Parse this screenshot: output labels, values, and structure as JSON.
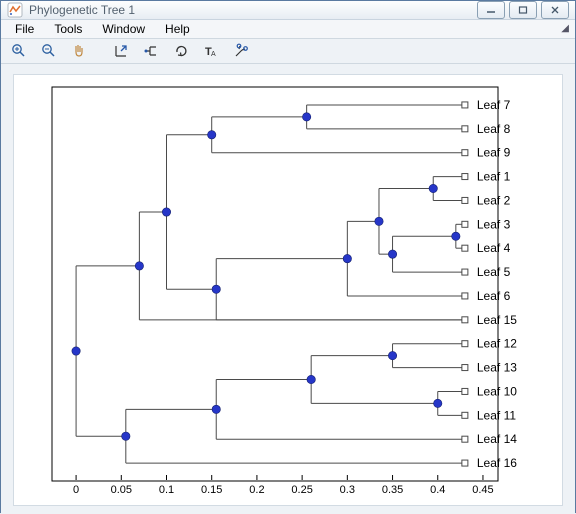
{
  "window": {
    "title": "Phylogenetic Tree 1"
  },
  "menu": {
    "file": "File",
    "tools": "Tools",
    "window": "Window",
    "help": "Help"
  },
  "toolbar_icons": [
    "zoom-in-icon",
    "zoom-out-icon",
    "pan-icon",
    "collapse-icon",
    "rotate-icon",
    "swap-icon",
    "rename-icon",
    "prune-icon"
  ],
  "chart_data": {
    "type": "phylotree",
    "x_ticks": [
      "0",
      "0.05",
      "0.1",
      "0.15",
      "0.2",
      "0.25",
      "0.3",
      "0.35",
      "0.4",
      "0.45"
    ],
    "x_range": [
      -0.02,
      0.46
    ],
    "leaves": [
      {
        "label": "Leaf 7",
        "x": 0.43
      },
      {
        "label": "Leaf 8",
        "x": 0.43
      },
      {
        "label": "Leaf 9",
        "x": 0.43
      },
      {
        "label": "Leaf 1",
        "x": 0.43
      },
      {
        "label": "Leaf 2",
        "x": 0.43
      },
      {
        "label": "Leaf 3",
        "x": 0.43
      },
      {
        "label": "Leaf 4",
        "x": 0.43
      },
      {
        "label": "Leaf 5",
        "x": 0.43
      },
      {
        "label": "Leaf 6",
        "x": 0.43
      },
      {
        "label": "Leaf 15",
        "x": 0.43
      },
      {
        "label": "Leaf 12",
        "x": 0.43
      },
      {
        "label": "Leaf 13",
        "x": 0.43
      },
      {
        "label": "Leaf 10",
        "x": 0.43
      },
      {
        "label": "Leaf 11",
        "x": 0.43
      },
      {
        "label": "Leaf 14",
        "x": 0.43
      },
      {
        "label": "Leaf 16",
        "x": 0.43
      }
    ],
    "internal_nodes": [
      {
        "x": 0.255,
        "between": [
          0,
          1
        ]
      },
      {
        "x": 0.15,
        "between": [
          0.5,
          2
        ]
      },
      {
        "x": 0.395,
        "between": [
          3,
          4
        ]
      },
      {
        "x": 0.42,
        "between": [
          5,
          6
        ]
      },
      {
        "x": 0.35,
        "between": [
          5.5,
          7
        ]
      },
      {
        "x": 0.335,
        "between": [
          3.5,
          6.25
        ]
      },
      {
        "x": 0.3,
        "between": [
          4.875,
          8
        ]
      },
      {
        "x": 0.155,
        "between": [
          6.4375,
          9
        ]
      },
      {
        "x": 0.1,
        "between": [
          1.25,
          7.72
        ]
      },
      {
        "x": 0.07,
        "between": [
          4.484,
          9
        ]
      },
      {
        "x": 0.35,
        "between": [
          10,
          11
        ]
      },
      {
        "x": 0.4,
        "between": [
          12,
          13
        ]
      },
      {
        "x": 0.26,
        "between": [
          10.5,
          12.5
        ]
      },
      {
        "x": 0.155,
        "between": [
          11.5,
          14
        ]
      },
      {
        "x": 0.055,
        "between": [
          12.75,
          15
        ]
      },
      {
        "x": 0.0,
        "between": [
          6.742,
          13.875
        ]
      }
    ]
  }
}
